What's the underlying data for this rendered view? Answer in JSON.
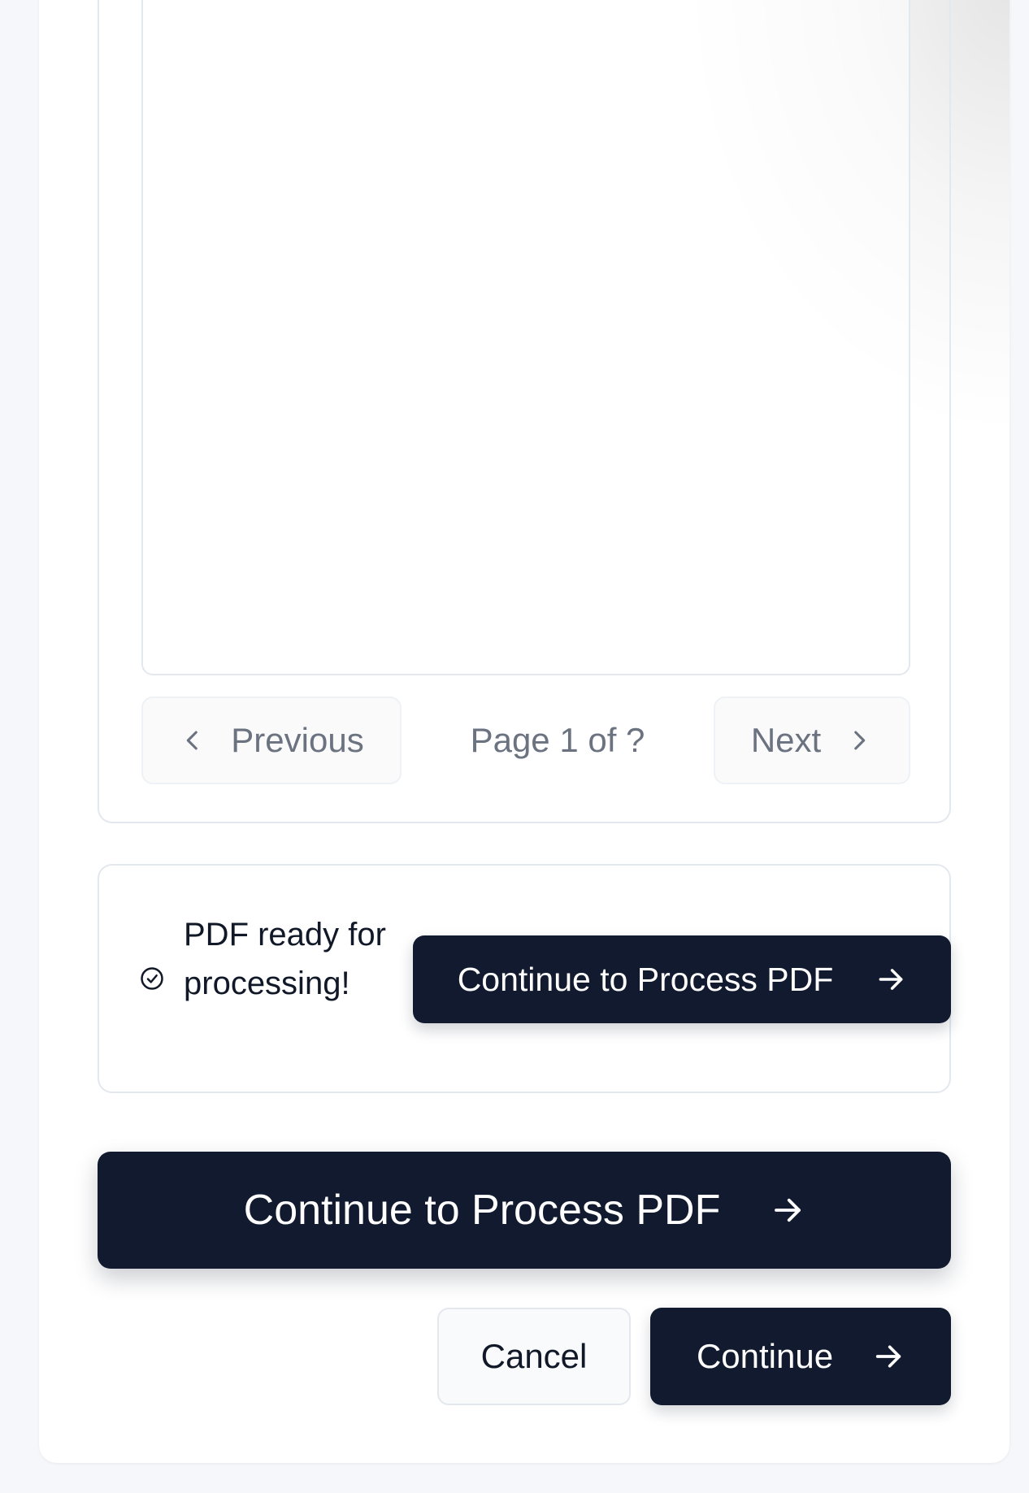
{
  "pager": {
    "previous_label": "Previous",
    "page_indicator": "Page 1 of ?",
    "next_label": "Next"
  },
  "ready_panel": {
    "message": "PDF ready for processing!",
    "icon": "check-circle-icon",
    "action_label": "Continue to Process PDF"
  },
  "main_action": {
    "label": "Continue to Process PDF"
  },
  "footer": {
    "cancel_label": "Cancel",
    "continue_label": "Continue"
  },
  "colors": {
    "primary": "#111a2e",
    "muted_text": "#6b7280",
    "border": "#e3e8ef"
  }
}
